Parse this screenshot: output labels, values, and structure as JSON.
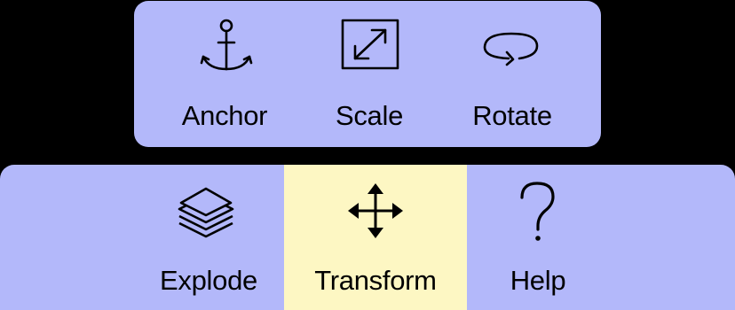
{
  "colors": {
    "background": "#000000",
    "panel": "#b3b8fa",
    "active_highlight": "#fdf7c3",
    "icon": "#000000"
  },
  "popover": {
    "items": [
      {
        "label": "Anchor",
        "icon": "anchor-icon"
      },
      {
        "label": "Scale",
        "icon": "scale-icon"
      },
      {
        "label": "Rotate",
        "icon": "rotate-icon"
      }
    ]
  },
  "toolbar": {
    "items": [
      {
        "label": "Explode",
        "icon": "layers-icon",
        "active": false
      },
      {
        "label": "Transform",
        "icon": "move-icon",
        "active": true
      },
      {
        "label": "Help",
        "icon": "question-mark-icon",
        "active": false
      }
    ]
  }
}
